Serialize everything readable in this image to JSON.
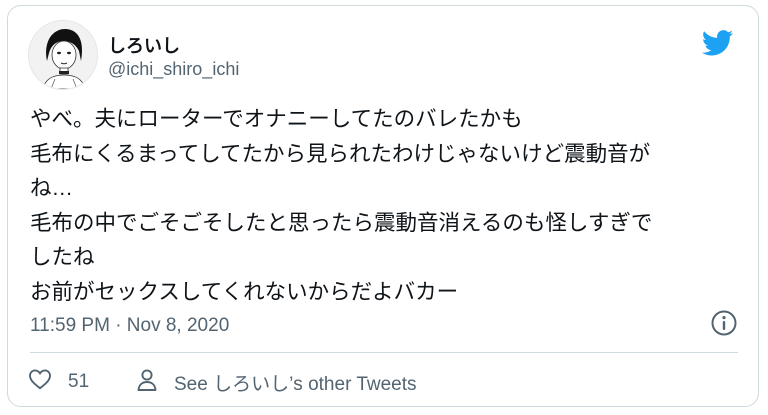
{
  "author": {
    "display_name": "しろいし",
    "handle": "@ichi_shiro_ichi"
  },
  "tweet": {
    "text": "やべ。夫にローターでオナニーしてたのバレたかも\n毛布にくるまってしてたから見られたわけじゃないけど震動音が\nね…\n毛布の中でごそごそしたと思ったら震動音消えるのも怪しすぎで\nしたね\nお前がセックスしてくれないからだよバカー",
    "timestamp": "11:59 PM · Nov 8, 2020"
  },
  "actions": {
    "like_count": "51",
    "see_more_label": "See しろいし’s other Tweets"
  },
  "icons": {
    "brand": "twitter-bird-icon",
    "info": "info-icon",
    "like": "heart-icon",
    "profile": "person-icon"
  },
  "colors": {
    "twitter_blue": "#1da1f2",
    "text_primary": "#0f1419",
    "text_secondary": "#536471",
    "border": "#cfd9de"
  }
}
